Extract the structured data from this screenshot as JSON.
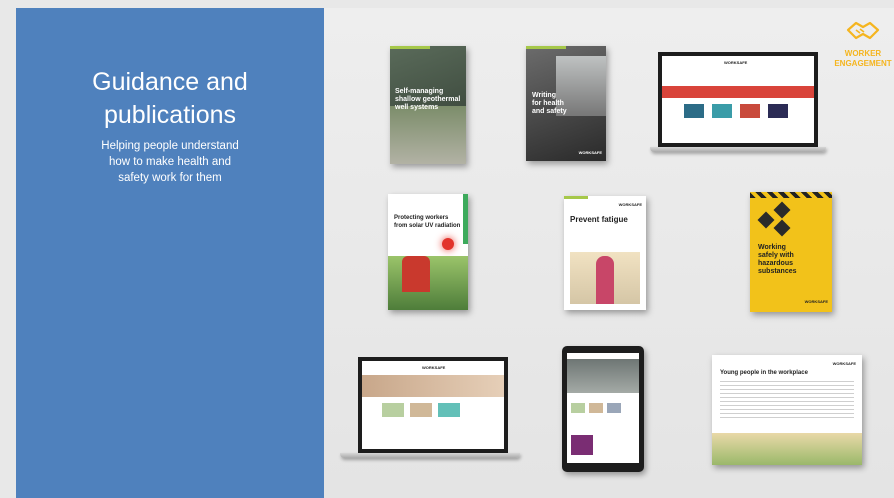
{
  "left": {
    "title_line1": "Guidance and",
    "title_line2": "publications",
    "subtitle_line1": "Helping people understand",
    "subtitle_line2": "how to make health and",
    "subtitle_line3": "safety work for them"
  },
  "logo": {
    "line1": "WORKER",
    "line2": "ENGAGEMENT",
    "icon": "handshake-icon"
  },
  "publications": [
    {
      "title_line1": "Self-managing",
      "title_line2": "shallow geothermal",
      "title_line3": "well systems"
    },
    {
      "title_line1": "Writing",
      "title_line2": "for health",
      "title_line3": "and safety"
    },
    {
      "title_line1": "Protecting workers",
      "title_line2": "from solar UV radiation"
    },
    {
      "title": "Prevent fatigue"
    },
    {
      "title_line1": "Working",
      "title_line2": "safely with",
      "title_line3": "hazardous",
      "title_line4": "substances"
    },
    {
      "title": "Young people in the workplace"
    }
  ],
  "brand": "WORKSAFE",
  "colors": {
    "panel_blue": "#4f81bd",
    "logo_gold": "#f5b51f",
    "accent_green": "#a6c84a"
  }
}
